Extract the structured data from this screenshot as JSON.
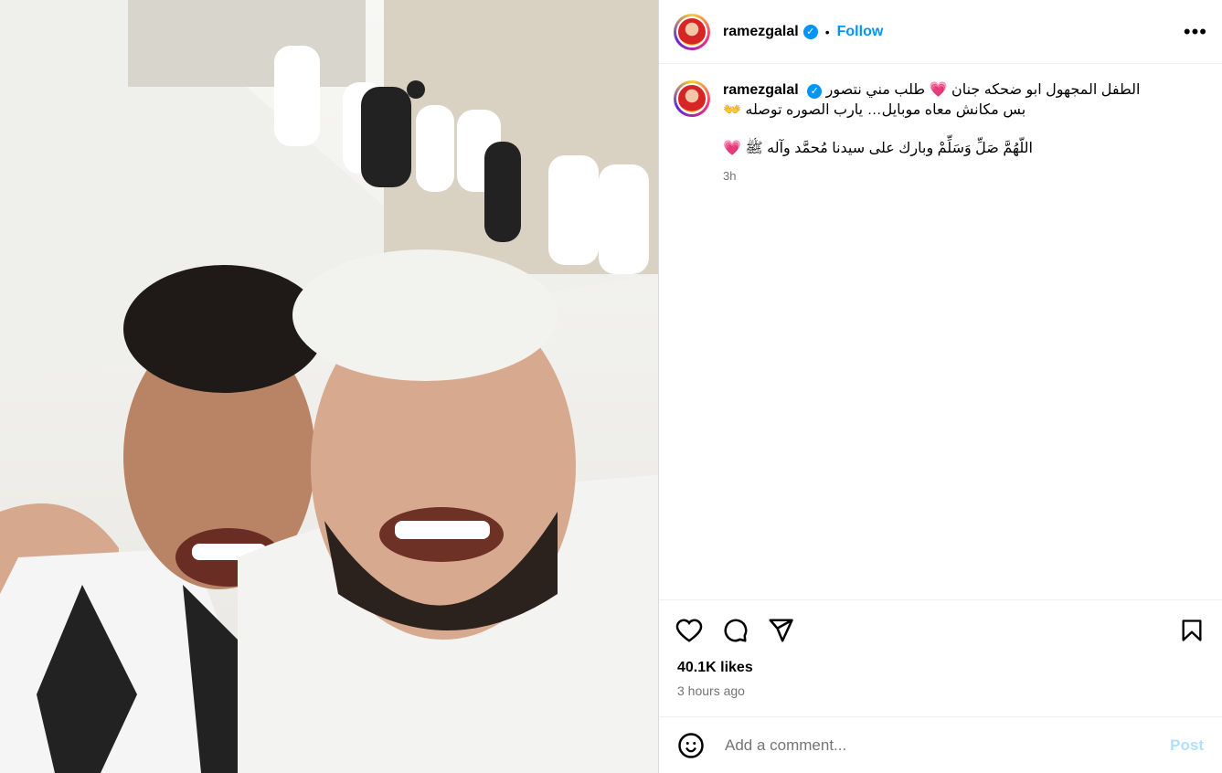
{
  "user": {
    "name": "ramezgalal",
    "follow": "Follow",
    "more": "•••"
  },
  "caption": {
    "line1": "الطفل المجهول ابو ضحكه جنان 💗 طلب مني نتصور",
    "line2": "بس مكانش معاه موبايل… يارب الصوره توصله 👐",
    "line3": "اللّهُمَّ صَلِّ وَسَلِّمْ وبارك على سيدنا مُحمَّد وآله ﷺ 💗",
    "time": "3h"
  },
  "stats": {
    "likes": "40.1K likes",
    "ago": "3 hours ago"
  },
  "comment": {
    "placeholder": "Add a comment...",
    "post": "Post"
  },
  "icons": [
    "heart-icon",
    "comment-icon",
    "share-icon",
    "bookmark-icon",
    "emoji-icon",
    "verified-icon"
  ]
}
